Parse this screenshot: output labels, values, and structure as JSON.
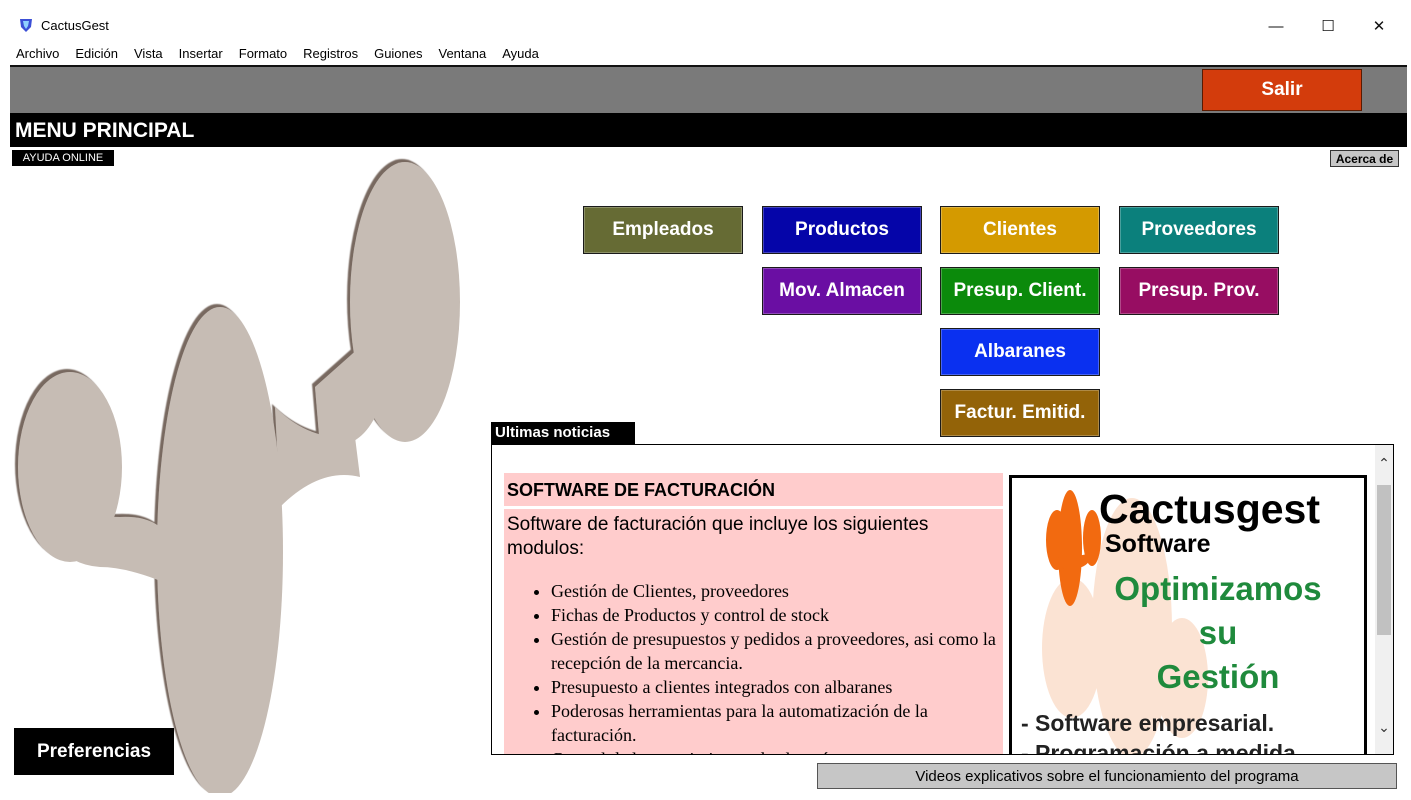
{
  "window": {
    "title": "CactusGest",
    "minimize_glyph": "—",
    "maximize_glyph": "☐",
    "close_glyph": "✕"
  },
  "menubar": [
    "Archivo",
    "Edición",
    "Vista",
    "Insertar",
    "Formato",
    "Registros",
    "Guiones",
    "Ventana",
    "Ayuda"
  ],
  "toolbar": {
    "exit_label": "Salir"
  },
  "header": {
    "title": "MENU PRINCIPAL"
  },
  "links": {
    "help_online": "AYUDA ONLINE",
    "about": "Acerca de"
  },
  "modules": {
    "empleados": {
      "label": "Empleados",
      "color": "#666b34"
    },
    "productos": {
      "label": "Productos",
      "color": "#0505a9"
    },
    "clientes": {
      "label": "Clientes",
      "color": "#d49a00"
    },
    "proveedores": {
      "label": "Proveedores",
      "color": "#0b807c"
    },
    "mov_almacen": {
      "label": "Mov. Almacen",
      "color": "#6a0ea3"
    },
    "presup_client": {
      "label": "Presup. Client.",
      "color": "#0b8a0b"
    },
    "presup_prov": {
      "label": "Presup. Prov.",
      "color": "#970d62"
    },
    "albaranes": {
      "label": "Albaranes",
      "color": "#0a30f0"
    },
    "factur_emitid": {
      "label": "Factur. Emitid.",
      "color": "#936308"
    }
  },
  "preferences_label": "Preferencias",
  "news": {
    "tab_label": "Ultimas noticias",
    "title": "SOFTWARE DE FACTURACIÓN",
    "intro": "Software de facturación que incluye los siguientes modulos:",
    "items": [
      "Gestión de Clientes, proveedores",
      "Fichas de Productos y control de stock",
      "Gestión de presupuestos y pedidos a proveedores, asi como la recepción de la mercancia.",
      "Presupuesto a clientes integrados con albaranes",
      "Poderosas herramientas para la  automatización de la facturación.",
      "Control de los movimientos de almacén"
    ],
    "ad": {
      "brand": "Cactusgest",
      "sub": "Software",
      "line1": "Optimizamos",
      "line2": "su",
      "line3": "Gestión",
      "feature1": "- Software empresarial.",
      "feature2": "- Programación a medida"
    }
  },
  "videos_label": "Videos explicativos sobre el funcionamiento del programa",
  "colors": {
    "exit": "#d33c0c",
    "toolbar": "#7a7a7a",
    "header": "#000000",
    "cactus": "#c6bcb4",
    "news_bg": "#ffcccc",
    "ad_green": "#1f8a3c",
    "ad_orange": "#f26a10"
  }
}
